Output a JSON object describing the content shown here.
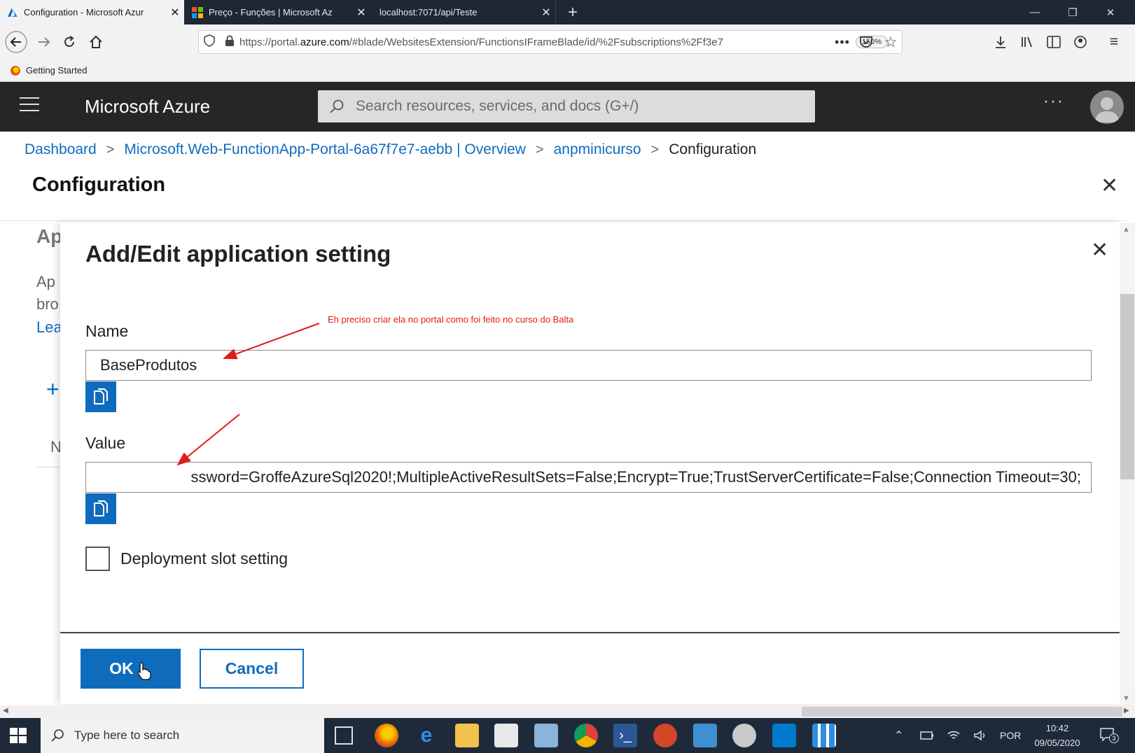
{
  "browser": {
    "tabs": [
      {
        "title": "Configuration - Microsoft Azur",
        "active": true,
        "icon": "azure-icon"
      },
      {
        "title": "Preço - Funções | Microsoft Az",
        "active": false,
        "icon": "microsoft-icon"
      },
      {
        "title": "localhost:7071/api/Teste",
        "active": false,
        "icon": ""
      }
    ],
    "new_tab_glyph": "+",
    "url": {
      "prefix": "https://portal.",
      "domain": "azure.com",
      "path": "/#blade/WebsitesExtension/FunctionsIFrameBlade/id/%2Fsubscriptions%2Ff3e7"
    },
    "zoom": "150%",
    "bookmarks": [
      {
        "label": "Getting Started"
      }
    ]
  },
  "azure": {
    "brand": "Microsoft Azure",
    "search_placeholder": "Search resources, services, and docs (G+/)",
    "more_glyph": "···"
  },
  "breadcrumb": {
    "items": [
      "Dashboard",
      "Microsoft.Web-FunctionApp-Portal-6a67f7e7-aebb | Overview",
      "anpminicurso"
    ],
    "current": "Configuration",
    "separator": ">"
  },
  "blade": {
    "title": "Configuration",
    "background_fragments": {
      "heading": "Ap",
      "line1": "Ap",
      "line2": "bro",
      "link": "Lea",
      "col": "N"
    }
  },
  "dialog": {
    "title": "Add/Edit application setting",
    "name_label": "Name",
    "name_value": "BaseProdutos",
    "value_label": "Value",
    "value_text": "ssword=GroffeAzureSql2020!;MultipleActiveResultSets=False;Encrypt=True;TrustServerCertificate=False;Connection Timeout=30;",
    "slot_setting_label": "Deployment slot setting",
    "slot_setting_checked": false,
    "ok_label": "OK",
    "cancel_label": "Cancel"
  },
  "annotation": {
    "text": "Eh preciso criar ela no portal como foi feito no curso do Balta",
    "color": "#e01b1b"
  },
  "taskbar": {
    "search_placeholder": "Type here to search",
    "language": "POR",
    "time": "10:42",
    "date": "09/05/2020",
    "notifications": "3"
  },
  "colors": {
    "accent": "#0f6cbd",
    "header": "#262626"
  }
}
